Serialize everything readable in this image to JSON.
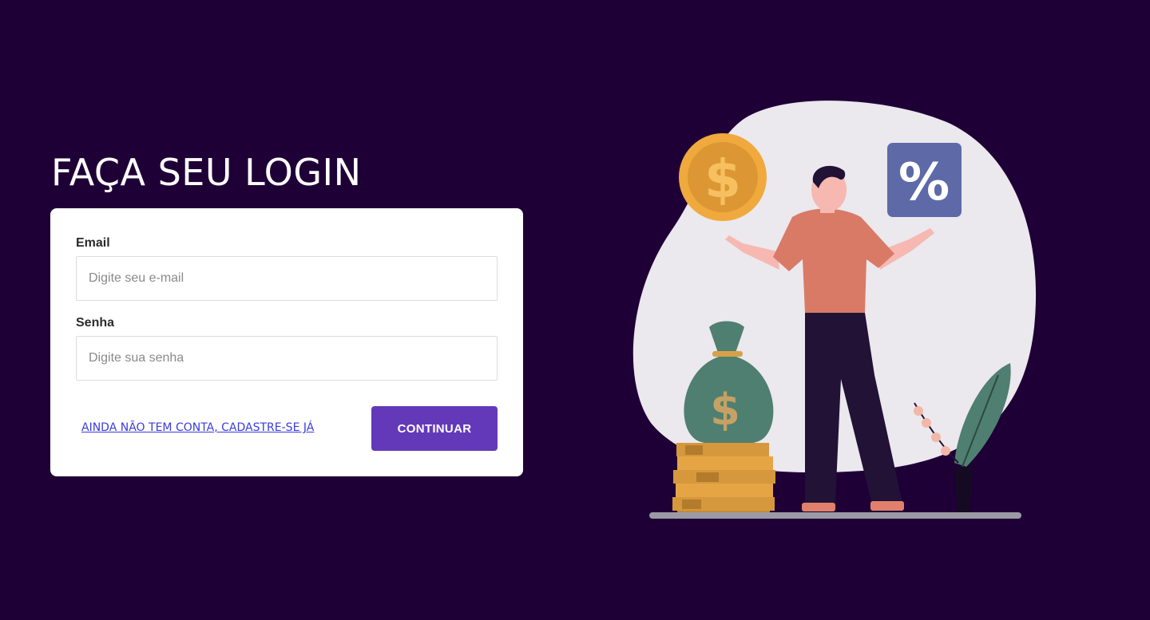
{
  "login": {
    "title": "FAÇA SEU LOGIN",
    "email_label": "Email",
    "email_placeholder": "Digite seu e-mail",
    "password_label": "Senha",
    "password_placeholder": "Digite sua senha",
    "signup_link": "AINDA NÃO TEM CONTA, CADASTRE-SE JÁ",
    "continue_button": "CONTINUAR"
  },
  "illustration": {
    "coin_symbol": "$",
    "bag_symbol": "$",
    "percent_symbol": "%"
  },
  "colors": {
    "background": "#1f0036",
    "accent": "#6339b9",
    "link": "#3b3bdb"
  }
}
